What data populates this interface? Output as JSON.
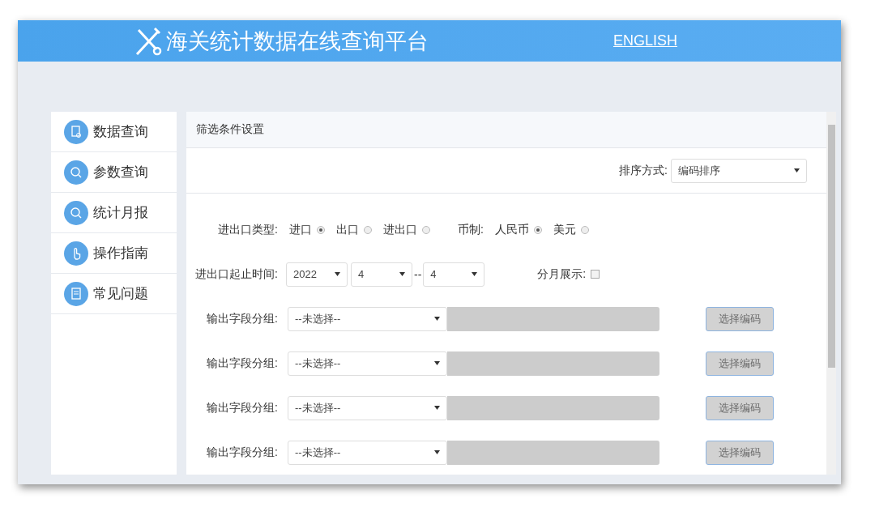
{
  "header": {
    "title": "海关统计数据在线查询平台",
    "language_link": "ENGLISH"
  },
  "sidebar": {
    "items": [
      {
        "label": "数据查询"
      },
      {
        "label": "参数查询"
      },
      {
        "label": "统计月报"
      },
      {
        "label": "操作指南"
      },
      {
        "label": "常见问题"
      }
    ]
  },
  "panel": {
    "title": "筛选条件设置",
    "sort": {
      "label": "排序方式:",
      "value": "编码排序"
    },
    "trade_type": {
      "label": "进出口类型:",
      "options": [
        {
          "label": "进口",
          "selected": true
        },
        {
          "label": "出口",
          "selected": false
        },
        {
          "label": "进出口",
          "selected": false
        }
      ]
    },
    "currency": {
      "label": "币制:",
      "options": [
        {
          "label": "人民币",
          "selected": true
        },
        {
          "label": "美元",
          "selected": false
        }
      ]
    },
    "period": {
      "label": "进出口起止时间:",
      "year": "2022",
      "from_month": "4",
      "separator": "--",
      "to_month": "4"
    },
    "monthly": {
      "label": "分月展示:",
      "checked": false
    },
    "groups": [
      {
        "label": "输出字段分组:",
        "value": "--未选择--",
        "button": "选择编码",
        "disabled": true
      },
      {
        "label": "输出字段分组:",
        "value": "--未选择--",
        "button": "选择编码",
        "disabled": true
      },
      {
        "label": "输出字段分组:",
        "value": "--未选择--",
        "button": "选择编码",
        "disabled": true
      },
      {
        "label": "输出字段分组:",
        "value": "--未选择--",
        "button": "选择编码",
        "disabled": true
      }
    ]
  }
}
